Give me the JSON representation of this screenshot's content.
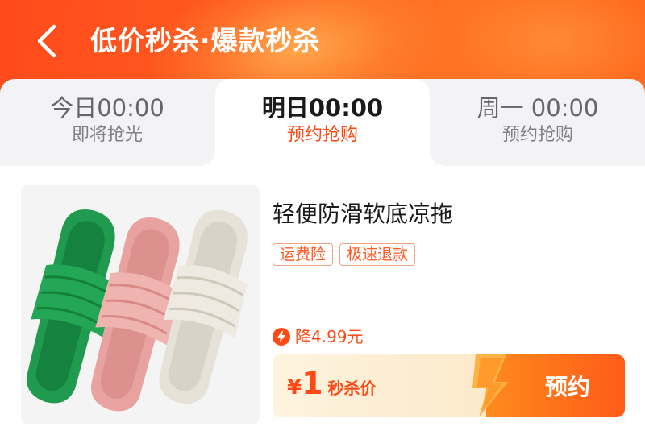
{
  "header": {
    "title": "低价秒杀·爆款秒杀",
    "back_icon": "chevron-left-icon"
  },
  "tabs": [
    {
      "time": "今日00:00",
      "status": "即将抢光",
      "active": false
    },
    {
      "time": "明日00:00",
      "status": "预约抢购",
      "active": true
    },
    {
      "time": "周一 00:00",
      "status": "预约抢购",
      "active": false
    }
  ],
  "product": {
    "name": "轻便防滑软底凉拖",
    "tags": [
      "运费险",
      "极速退款"
    ],
    "discount_icon": "lightning-icon",
    "discount_text": "降4.99元",
    "price_currency": "¥",
    "price_value": "1",
    "price_label": "秒杀价",
    "reserve_label": "预约"
  },
  "colors": {
    "brand": "#ff4a15",
    "header_gradient_start": "#ff4a1c",
    "header_gradient_end": "#ff7424",
    "tab_bg": "#f3f3f5",
    "buybar_light": "#fdf0dc",
    "button_orange": "#ff5b18"
  }
}
